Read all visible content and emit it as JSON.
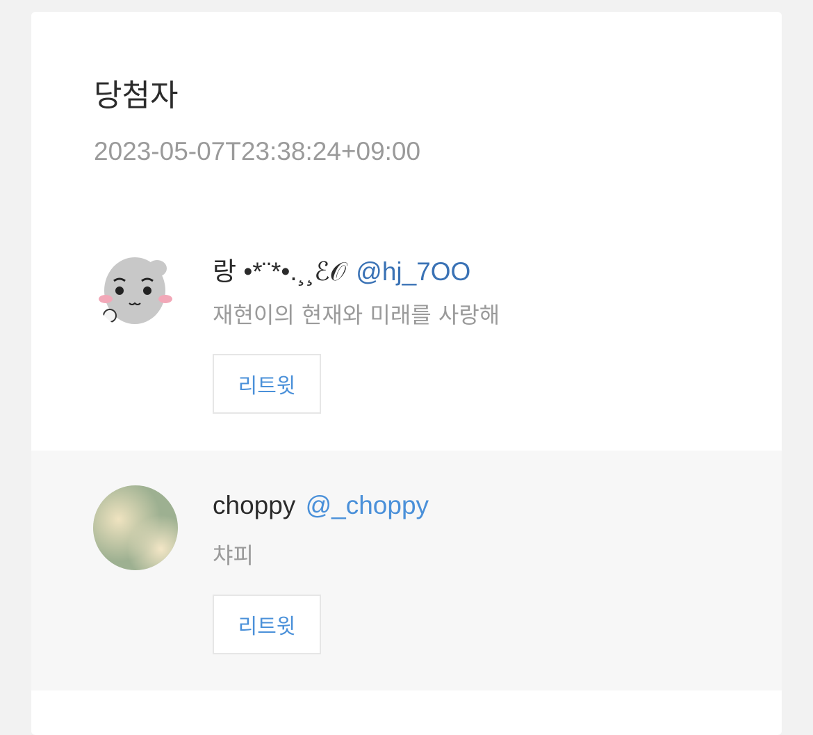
{
  "header": {
    "title": "당첨자",
    "timestamp": "2023-05-07T23:38:24+09:00"
  },
  "winners": [
    {
      "display_name": "랑 •*¨*•.¸¸ℰ𝒪",
      "handle": "@hj_7OO",
      "bio": "재현이의 현재와 미래를 사랑해",
      "retweet_label": "리트윗"
    },
    {
      "display_name": "choppy",
      "handle": "@_choppy",
      "bio": "챠피",
      "retweet_label": "리트윗"
    }
  ],
  "colors": {
    "page_bg": "#f2f2f2",
    "card_bg": "#ffffff",
    "alt_row_bg": "#f7f7f7",
    "handle_dark": "#3a72b5",
    "handle_light": "#4a90d9",
    "muted_text": "#9a9a9a"
  }
}
